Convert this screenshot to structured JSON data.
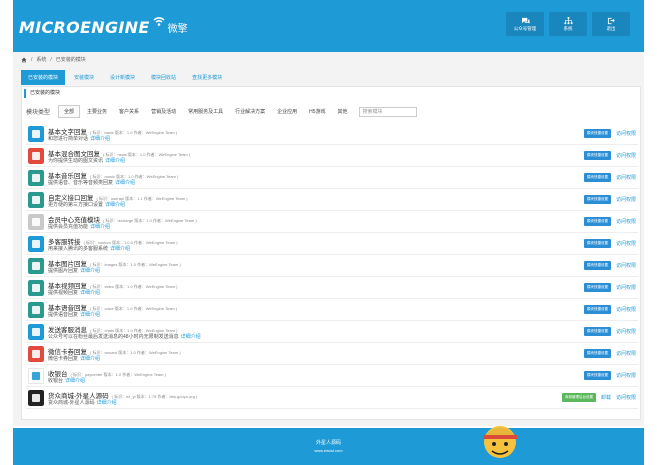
{
  "header": {
    "logo_text": "MICROENGINE",
    "logo_cn": "微擎",
    "buttons": [
      {
        "label": "公众号管理",
        "icon": "chat-icon"
      },
      {
        "label": "系统",
        "icon": "sitemap-icon"
      },
      {
        "label": "退出",
        "icon": "logout-icon"
      }
    ]
  },
  "breadcrumb": [
    "系统",
    "已安装的模块"
  ],
  "tabs": [
    "已安装的模块",
    "安装模块",
    "设计新模块",
    "模块回收站",
    "查找更多模块"
  ],
  "card_title": "已安装的模块",
  "filters": {
    "label": "模块类型",
    "items": [
      "全部",
      "主要业务",
      "客户关系",
      "营销及活动",
      "常用服务及工具",
      "行业解决方案",
      "企业应用",
      "H5游戏",
      "其他"
    ],
    "search_placeholder": "搜索模块"
  },
  "common": {
    "detail_link": "详细介绍",
    "shortcut_btn": "模块快捷设置",
    "access_link": "访问权限"
  },
  "modules": [
    {
      "name": "基本文字回复",
      "meta": "( 标识：basic  版本：1.0  作者：WeEngine Team )",
      "desc": "和您进行简单对话",
      "icon": "text-reply-icon",
      "color": "#1e9ad6"
    },
    {
      "name": "基本混合图文回复",
      "meta": "( 标识：news  版本：1.0  作者：WeEngine Team )",
      "desc": "为你提供生动的图文资讯",
      "icon": "news-reply-icon",
      "color": "#e24a3e"
    },
    {
      "name": "基本音乐回复",
      "meta": "( 标识：music  版本：1.0  作者：WeEngine Team )",
      "desc": "提供语音、音乐等音频类回复",
      "icon": "music-reply-icon",
      "color": "#2a9a8f"
    },
    {
      "name": "自定义接口回复",
      "meta": "( 标识：userapi  版本：1.1  作者：WeEngine Team )",
      "desc": "更方便的第三方接口设置",
      "icon": "api-icon",
      "color": "#2a9a8f"
    },
    {
      "name": "会员中心充值模块",
      "meta": "( 标识：recharge  版本：1.0  作者：WeEngine Team )",
      "desc": "提供会员充值功能",
      "icon": "recharge-icon",
      "color": "#c9c9c9"
    },
    {
      "name": "多客服转接",
      "meta": "( 标识：custom  版本：1.0.0  作者：WeEngine Team )",
      "desc": "用来接入腾讯的多客服系统",
      "icon": "custom-service-icon",
      "color": "#1e9ad6"
    },
    {
      "name": "基本图片回复",
      "meta": "( 标识：images  版本：1.0  作者：WeEngine Team )",
      "desc": "提供图片回复",
      "icon": "image-reply-icon",
      "color": "#2a9a8f"
    },
    {
      "name": "基本视频回复",
      "meta": "( 标识：video  版本：1.0  作者：WeEngine Team )",
      "desc": "提供视频回复",
      "icon": "video-reply-icon",
      "color": "#2a9a8f"
    },
    {
      "name": "基本语音回复",
      "meta": "( 标识：voice  版本：1.0  作者：WeEngine Team )",
      "desc": "提供语音回复",
      "icon": "voice-reply-icon",
      "color": "#2a9a8f"
    },
    {
      "name": "发送客服消息",
      "meta": "( 标识：chats  版本：1.0  作者：WeEngine Team )",
      "desc": "公众号可以在粉丝最后发送消息的48小时内无限制发送消息",
      "icon": "chat-message-icon",
      "color": "#1e9ad6"
    },
    {
      "name": "微信卡券回复",
      "meta": "( 标识：wxcard  版本：1.0  作者：WeEngine Team )",
      "desc": "微信卡券回复",
      "icon": "card-coupon-icon",
      "color": "#e24a3e"
    },
    {
      "name": "收银台",
      "meta": "( 标识：paycenter  版本：1.0  作者：WeEngine Team )",
      "desc": "收银台",
      "icon": "cashier-icon",
      "color": "#ffffff"
    },
    {
      "name": "货众商城-外星人源码",
      "meta": "( 标识：ez_yi  版本：1.75  作者：bbs.gouyu.org )",
      "desc": "货众商城-外星人源码",
      "icon": "mall-icon",
      "color": "#222222",
      "extra_btn": "商城管理后台设置",
      "extra_link": "卸载"
    }
  ],
  "footer": {
    "line1": "外星人源码",
    "line2": "www.ewxsl.com"
  },
  "watermark": "我爱代码"
}
